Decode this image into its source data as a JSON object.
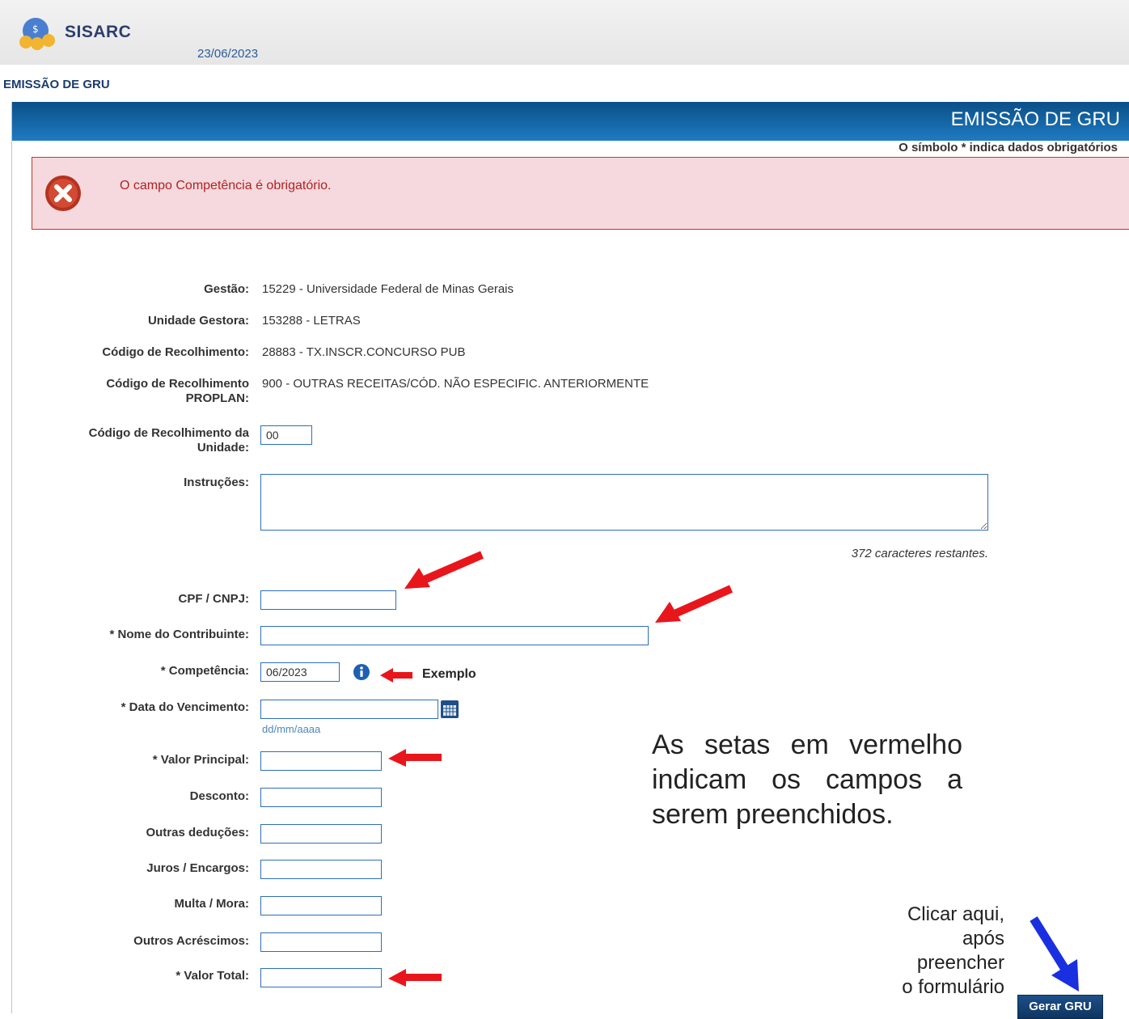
{
  "app": {
    "name": "SISARC",
    "date": "23/06/2023",
    "breadcrumb": "EMISSÃO DE GRU"
  },
  "panel": {
    "title": "EMISSÃO DE GRU"
  },
  "error": {
    "message": "O campo Competência é obrigatório."
  },
  "required_note": "O símbolo * indica dados obrigatórios",
  "info": {
    "gestao": {
      "label": "Gestão:",
      "value": "15229 - Universidade Federal de Minas Gerais"
    },
    "unidade_gestora": {
      "label": "Unidade Gestora:",
      "value": "153288 - LETRAS"
    },
    "codigo_recolhimento": {
      "label": "Código de Recolhimento:",
      "value": "28883 - TX.INSCR.CONCURSO PUB"
    },
    "codigo_proplan": {
      "label_line1": "Código de Recolhimento",
      "label_line2": "PROPLAN:",
      "value": "900 - OUTRAS RECEITAS/CÓD. NÃO ESPECIFIC. ANTERIORMENTE"
    }
  },
  "form": {
    "codigo_unidade": {
      "label_line1": "Código de Recolhimento da",
      "label_line2": "Unidade:",
      "value": "00"
    },
    "instrucoes": {
      "label": "Instruções:",
      "value": "",
      "counter": "372 caracteres restantes."
    },
    "cpf_cnpj": {
      "label": "CPF / CNPJ:",
      "value": ""
    },
    "nome_contribuinte": {
      "label": "* Nome do Contribuinte:",
      "value": ""
    },
    "competencia": {
      "label": "* Competência:",
      "value": "06/2023"
    },
    "data_vencimento": {
      "label": "* Data do Vencimento:",
      "value": "",
      "hint": "dd/mm/aaaa"
    },
    "valor_principal": {
      "label": "* Valor Principal:",
      "value": ""
    },
    "desconto": {
      "label": "Desconto:",
      "value": ""
    },
    "outras_deducoes": {
      "label": "Outras deduções:",
      "value": ""
    },
    "juros_encargos": {
      "label": "Juros / Encargos:",
      "value": ""
    },
    "multa_mora": {
      "label": "Multa / Mora:",
      "value": ""
    },
    "outros_acrescimos": {
      "label": "Outros Acréscimos:",
      "value": ""
    },
    "valor_total": {
      "label": "* Valor Total:",
      "value": ""
    },
    "submit_label": "Gerar GRU"
  },
  "annotations": {
    "exemplo": "Exemplo",
    "note_big": "As setas em vermelho indicam os campos a serem preenchidos.",
    "note_small_lines": [
      "Clicar aqui,",
      "após",
      "preencher",
      "o formulário"
    ],
    "arrow_color_fields": "#e8161b",
    "arrow_color_button": "#1a2fe0"
  },
  "colors": {
    "header_dark": "#0b4f88",
    "header_light": "#1e7bc0",
    "error_bg": "#f5d9de",
    "error_border": "#c0392b",
    "input_border": "#2c6fb8"
  },
  "icons": [
    "sisarc-logo-icon",
    "error-x-icon",
    "info-icon",
    "calendar-icon"
  ]
}
